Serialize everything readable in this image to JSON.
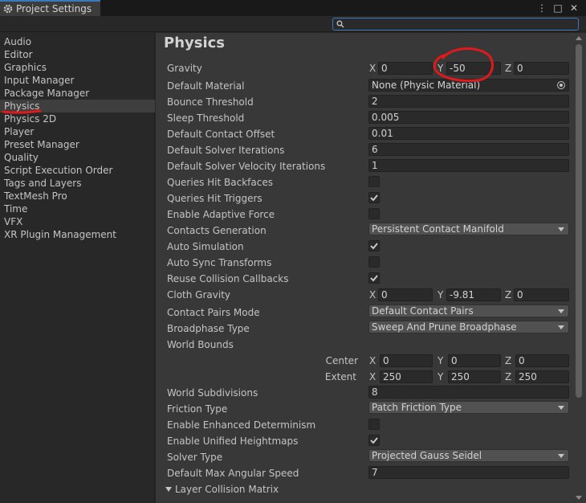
{
  "window": {
    "title": "Project Settings"
  },
  "search": {
    "placeholder": "",
    "value": ""
  },
  "sidebar": {
    "items": [
      "Audio",
      "Editor",
      "Graphics",
      "Input Manager",
      "Package Manager",
      "Physics",
      "Physics 2D",
      "Player",
      "Preset Manager",
      "Quality",
      "Script Execution Order",
      "Tags and Layers",
      "TextMesh Pro",
      "Time",
      "VFX",
      "XR Plugin Management"
    ],
    "selected": "Physics"
  },
  "page": {
    "title": "Physics"
  },
  "fields": {
    "gravity": {
      "label": "Gravity",
      "x": "0",
      "y": "-50",
      "z": "0"
    },
    "default_material": {
      "label": "Default Material",
      "value": "None (Physic Material)"
    },
    "bounce_threshold": {
      "label": "Bounce Threshold",
      "value": "2"
    },
    "sleep_threshold": {
      "label": "Sleep Threshold",
      "value": "0.005"
    },
    "default_contact_offset": {
      "label": "Default Contact Offset",
      "value": "0.01"
    },
    "default_solver_iterations": {
      "label": "Default Solver Iterations",
      "value": "6"
    },
    "default_solver_velocity_iterations": {
      "label": "Default Solver Velocity Iterations",
      "value": "1"
    },
    "queries_hit_backfaces": {
      "label": "Queries Hit Backfaces",
      "checked": false
    },
    "queries_hit_triggers": {
      "label": "Queries Hit Triggers",
      "checked": true
    },
    "enable_adaptive_force": {
      "label": "Enable Adaptive Force",
      "checked": false
    },
    "contacts_generation": {
      "label": "Contacts Generation",
      "value": "Persistent Contact Manifold"
    },
    "auto_simulation": {
      "label": "Auto Simulation",
      "checked": true
    },
    "auto_sync_transforms": {
      "label": "Auto Sync Transforms",
      "checked": false
    },
    "reuse_collision_callbacks": {
      "label": "Reuse Collision Callbacks",
      "checked": true
    },
    "cloth_gravity": {
      "label": "Cloth Gravity",
      "x": "0",
      "y": "-9.81",
      "z": "0"
    },
    "contact_pairs_mode": {
      "label": "Contact Pairs Mode",
      "value": "Default Contact Pairs"
    },
    "broadphase_type": {
      "label": "Broadphase Type",
      "value": "Sweep And Prune Broadphase"
    },
    "world_bounds": {
      "label": "World Bounds",
      "center_label": "Center",
      "center": {
        "x": "0",
        "y": "0",
        "z": "0"
      },
      "extent_label": "Extent",
      "extent": {
        "x": "250",
        "y": "250",
        "z": "250"
      }
    },
    "world_subdivisions": {
      "label": "World Subdivisions",
      "value": "8"
    },
    "friction_type": {
      "label": "Friction Type",
      "value": "Patch Friction Type"
    },
    "enable_enhanced_determinism": {
      "label": "Enable Enhanced Determinism",
      "checked": false
    },
    "enable_unified_heightmaps": {
      "label": "Enable Unified Heightmaps",
      "checked": true
    },
    "solver_type": {
      "label": "Solver Type",
      "value": "Projected Gauss Seidel"
    },
    "default_max_angular_speed": {
      "label": "Default Max Angular Speed",
      "value": "7"
    }
  },
  "foldout": {
    "layer_collision_matrix": "Layer Collision Matrix"
  },
  "axes": {
    "x": "X",
    "y": "Y",
    "z": "Z"
  },
  "colors": {
    "accent": "#3a79bb",
    "annotation": "#e0191c",
    "panel": "#383838",
    "sidebar": "#282828"
  },
  "icons": [
    "gear-icon",
    "kebab-menu-icon",
    "maximize-icon",
    "close-icon",
    "search-icon",
    "help-icon",
    "preset-icon",
    "settings-icon",
    "object-picker-icon",
    "checkmark-icon",
    "dropdown-arrow-icon",
    "foldout-arrow-icon"
  ]
}
